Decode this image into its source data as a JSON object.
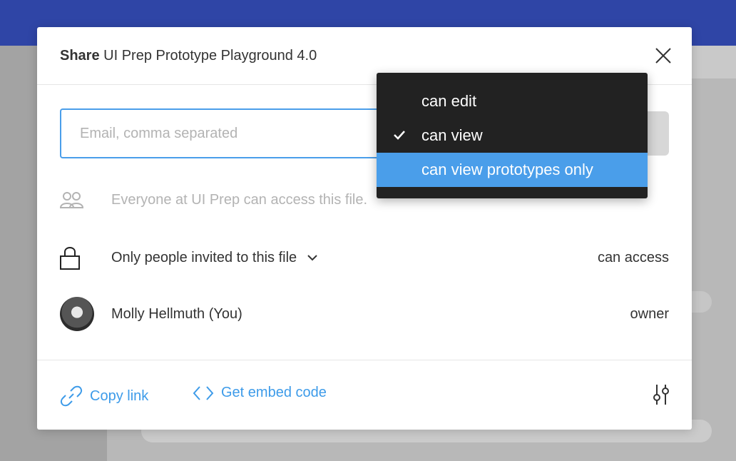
{
  "modal": {
    "title_verb": "Share",
    "title_file": "UI Prep Prototype Playground 4.0"
  },
  "invite": {
    "placeholder": "Email, comma separated",
    "value": ""
  },
  "team_access": {
    "icon": "team-icon",
    "text": "Everyone at UI Prep can access this file."
  },
  "link_access": {
    "icon": "lock-icon",
    "label": "Only people invited to this file",
    "permission": "can access"
  },
  "members": [
    {
      "name": "Molly Hellmuth (You)",
      "role": "owner"
    }
  ],
  "footer": {
    "copy_link": "Copy link",
    "embed_code": "Get embed code"
  },
  "permission_menu": {
    "items": [
      {
        "label": "can edit",
        "checked": false,
        "highlighted": false
      },
      {
        "label": "can view",
        "checked": true,
        "highlighted": false
      },
      {
        "label": "can view prototypes only",
        "checked": false,
        "highlighted": true
      }
    ]
  },
  "colors": {
    "accent": "#4a9eea",
    "link": "#3d9be9",
    "menu_bg": "#222222",
    "topbar": "#2f45a6"
  }
}
